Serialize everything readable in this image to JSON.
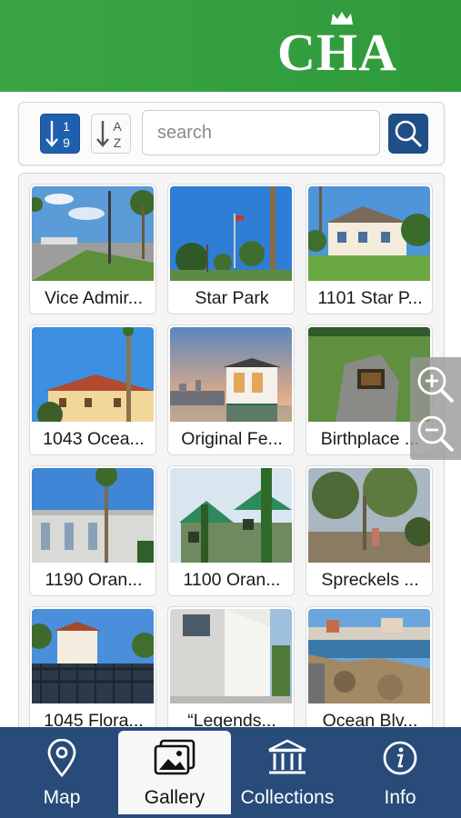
{
  "header": {
    "logo_text": "CHA",
    "bg_color": "#3aa447"
  },
  "toolbar": {
    "sort_numeric_icon": "sort-numeric-icon",
    "sort_numeric_digits": [
      "1",
      "9"
    ],
    "sort_alpha_icon": "sort-alpha-icon",
    "sort_alpha_letters": [
      "A",
      "Z"
    ],
    "search": {
      "placeholder": "search",
      "value": ""
    },
    "search_icon": "magnifier-icon",
    "accent": "#1f5fae"
  },
  "gallery": {
    "items": [
      {
        "label": "Vice Admir..."
      },
      {
        "label": "Star Park"
      },
      {
        "label": "1101 Star P..."
      },
      {
        "label": "1043 Ocea..."
      },
      {
        "label": "Original Fe..."
      },
      {
        "label": "Birthplace ..."
      },
      {
        "label": "1190 Oran..."
      },
      {
        "label": "1100 Oran..."
      },
      {
        "label": "Spreckels ..."
      },
      {
        "label": "1045 Flora..."
      },
      {
        "label": "“Legends..."
      },
      {
        "label": "Ocean Blv..."
      }
    ]
  },
  "zoom": {
    "in_icon": "zoom-in-icon",
    "out_icon": "zoom-out-icon"
  },
  "tabbar": {
    "bg_color": "#284b79",
    "tabs": [
      {
        "label": "Map",
        "icon": "map-pin-icon",
        "active": false
      },
      {
        "label": "Gallery",
        "icon": "gallery-icon",
        "active": true
      },
      {
        "label": "Collections",
        "icon": "museum-icon",
        "active": false
      },
      {
        "label": "Info",
        "icon": "info-icon",
        "active": false
      }
    ]
  }
}
